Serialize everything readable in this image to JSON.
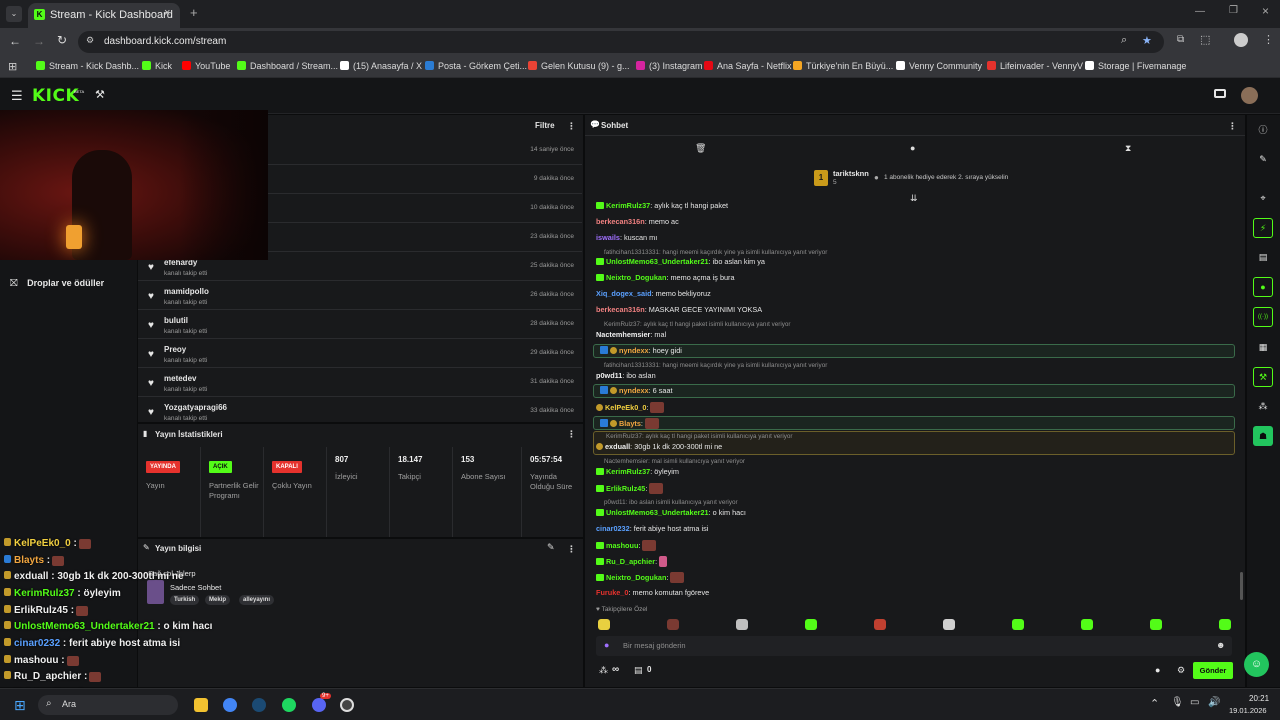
{
  "browser": {
    "tab_title": "Stream - Kick Dashboard",
    "url": "dashboard.kick.com/stream",
    "bookmarks": [
      {
        "label": "Stream - Kick Dashb...",
        "color": "#53fc18"
      },
      {
        "label": "Kick",
        "color": "#53fc18"
      },
      {
        "label": "YouTube",
        "color": "#ff0000"
      },
      {
        "label": "Dashboard / Stream...",
        "color": "#53fc18"
      },
      {
        "label": "(15) Anasayfa / X",
        "color": "#ffffff"
      },
      {
        "label": "Posta - Görkem Çeti...",
        "color": "#2b7cd3"
      },
      {
        "label": "Gelen Kutusu (9) - g...",
        "color": "#ea4335"
      },
      {
        "label": "(3) Instagram",
        "color": "#d6249f"
      },
      {
        "label": "Ana Sayfa - Netflix",
        "color": "#e50914"
      },
      {
        "label": "Türkiye'nin En Büyü...",
        "color": "#f5a623"
      },
      {
        "label": "Venny Community",
        "color": "#ffffff"
      },
      {
        "label": "Lifeinvader - VennyV",
        "color": "#e5322d"
      },
      {
        "label": "Storage | Fivemanage",
        "color": "#ffffff"
      }
    ]
  },
  "kick": {
    "logo": "KICK",
    "logo_beta": "BETA"
  },
  "sidebar": {
    "drops_label": "Droplar ve ödüller"
  },
  "activity": {
    "filter_label": "Filtre",
    "top_times": [
      "14 saniye önce",
      "9 dakika önce",
      "10 dakika önce",
      "23 dakika önce"
    ],
    "rows": [
      {
        "name": "efehardy",
        "sub": "kanalı takip etti",
        "time": "25 dakika önce"
      },
      {
        "name": "mamidpollo",
        "sub": "kanalı takip etti",
        "time": "26 dakika önce"
      },
      {
        "name": "bulutil",
        "sub": "kanalı takip etti",
        "time": "28 dakika önce"
      },
      {
        "name": "Preoy",
        "sub": "kanalı takip etti",
        "time": "29 dakika önce"
      },
      {
        "name": "metedev",
        "sub": "kanalı takip etti",
        "time": "31 dakika önce"
      },
      {
        "name": "Yozgatyapragi66",
        "sub": "kanalı takip etti",
        "time": "33 dakika önce"
      }
    ]
  },
  "stats": {
    "title": "Yayın İstatistikleri",
    "items": [
      {
        "badge": "YAYINDA",
        "badge_color": "#e5322d",
        "badge_text": "#ffffff",
        "label": "Yayın"
      },
      {
        "badge": "AÇIK",
        "badge_color": "#53fc18",
        "badge_text": "#0b0c0d",
        "label": "Partnerlik Gelir Programı"
      },
      {
        "badge": "KAPALI",
        "badge_color": "#e5322d",
        "badge_text": "#ffffff",
        "label": "Çoklu Yayın"
      },
      {
        "value": "807",
        "label": "İzleyici"
      },
      {
        "value": "18.147",
        "label": "Takipçi"
      },
      {
        "value": "153",
        "label": "Abone Sayısı"
      },
      {
        "value": "05:57:54",
        "label": "Yayında Olduğu Süre"
      }
    ]
  },
  "stream_info": {
    "title": "Yayın bilgisi",
    "stream_title": "Sağ sol Jblerp",
    "category": "Sadece Sohbet",
    "tags": [
      "Turkish",
      "Mekip",
      "alleyayını"
    ]
  },
  "chat": {
    "title": "Sohbet",
    "top_user": {
      "rank": "1",
      "name": "tariktsknn",
      "count": "5",
      "message": "1 abonelik hediye ederek 2. sıraya yükselin"
    },
    "lines": [
      {
        "type": "msg",
        "user": "KerimRulz37",
        "color": "#53fc18",
        "text": ": aylık kaç tl hangi paket"
      },
      {
        "type": "msg",
        "user": "berkecan316n",
        "color": "#f08080",
        "text": ": memo ac"
      },
      {
        "type": "msg",
        "user": "iswails",
        "color": "#a070ff",
        "text": ": kuscan mı"
      },
      {
        "type": "reply",
        "text": "fatihcihan13313331: hangi meemi kaçırdık yine ya isimli kullanıcıya yanıt veriyor"
      },
      {
        "type": "msg",
        "user": "UnlostMemo63_Undertaker21",
        "color": "#53fc18",
        "text": ": ibo aslan kim ya"
      },
      {
        "type": "msg",
        "user": "Neixtro_Dogukan",
        "color": "#53fc18",
        "text": ": memo açma iş bura"
      },
      {
        "type": "msg",
        "user": "Xiq_dogex_said",
        "color": "#5aa0ff",
        "text": ": memo bekliyoruz"
      },
      {
        "type": "msg",
        "user": "berkecan316n",
        "color": "#f08080",
        "text": ": MASKAR GECE YAYINIMI YOKSA"
      },
      {
        "type": "reply",
        "text": "KerimRulz37: aylık kaç tl hangi paket isimli kullanıcıya yanıt veriyor"
      },
      {
        "type": "msg",
        "user": "Nactemhemsier",
        "color": "#f0f0f0",
        "text": ": mal"
      },
      {
        "type": "msg",
        "user": "nyndexx",
        "color": "#f2a640",
        "text": ": hoey gidi"
      },
      {
        "type": "reply",
        "text": "fatihcihan13313331: hangi meemi kaçırdık yine ya isimli kullanıcıya yanıt veriyor"
      },
      {
        "type": "msg",
        "user": "p0wd11",
        "color": "#f0f0f0",
        "text": ": ibo aslan"
      },
      {
        "type": "msg",
        "user": "nyndexx",
        "color": "#f2a640",
        "text": ": 6 saat"
      },
      {
        "type": "msg",
        "user": "KelPeEk0_0",
        "color": "#f2d040",
        "text": ":"
      },
      {
        "type": "msg",
        "user": "Blayts",
        "color": "#f2a640",
        "text": ":"
      },
      {
        "type": "reply",
        "text": "KerimRulz37: aylık kaç tl hangi paket isimli kullanıcıya yanıt veriyor"
      },
      {
        "type": "msg",
        "user": "exduall",
        "color": "#f0f0f0",
        "text": ": 30gb 1k dk 200-300tl mi ne"
      },
      {
        "type": "reply",
        "text": "Nactemhemsier: mal isimli kullanıcıya yanıt veriyor"
      },
      {
        "type": "msg",
        "user": "KerimRulz37",
        "color": "#53fc18",
        "text": ": öyleyim"
      },
      {
        "type": "msg",
        "user": "ErlikRulz45",
        "color": "#53fc18",
        "text": ":"
      },
      {
        "type": "reply",
        "text": "p0wd11: ibo aslan isimli kullanıcıya yanıt veriyor"
      },
      {
        "type": "msg",
        "user": "UnlostMemo63_Undertaker21",
        "color": "#53fc18",
        "text": ": o kim hacı"
      },
      {
        "type": "msg",
        "user": "cinar0232",
        "color": "#5aa0ff",
        "text": ": ferit abiye host atma isi"
      },
      {
        "type": "msg",
        "user": "mashouu",
        "color": "#53fc18",
        "text": ":"
      },
      {
        "type": "msg",
        "user": "Ru_D_apchier",
        "color": "#53fc18",
        "text": ":"
      },
      {
        "type": "msg",
        "user": "Neixtro_Dogukan",
        "color": "#53fc18",
        "text": ":"
      },
      {
        "type": "msg",
        "user": "Furuke_0",
        "color": "#e5322d",
        "text": ": memo komutan fgöreve"
      }
    ],
    "followers_only_label": "Takipçilere Özel",
    "input_placeholder": "Bir mesaj gönderin",
    "points_label": "∞",
    "zero_label": "0",
    "send_label": "Gönder"
  },
  "overlay_chat": [
    {
      "user": "KelPeEk0_0",
      "color": "#f2d040",
      "text": " :"
    },
    {
      "user": "Blayts",
      "color": "#f2a640",
      "text": " :"
    },
    {
      "user": "exduall",
      "color": "#f0f0f0",
      "text": " : 30gb 1k dk 200-300tl mi ne"
    },
    {
      "user": "KerimRulz37",
      "color": "#53fc18",
      "text": " : öyleyim"
    },
    {
      "user": "ErlikRulz45",
      "color": "#f0f0f0",
      "text": " :"
    },
    {
      "user": "UnlostMemo63_Undertaker21",
      "color": "#53fc18",
      "text": " : o kim hacı"
    },
    {
      "user": "cinar0232",
      "color": "#5aa0ff",
      "text": " : ferit abiye host atma isi"
    },
    {
      "user": "mashouu",
      "color": "#f0f0f0",
      "text": " :"
    },
    {
      "user": "Ru_D_apchier",
      "color": "#f0f0f0",
      "text": " :"
    },
    {
      "user": "Neixtro_Dogukan",
      "color": "#53fc18",
      "text": " :"
    },
    {
      "user": "Furuke_0",
      "color": "#e5322d",
      "text": " : memo komutan fgöreve"
    }
  ],
  "taskbar": {
    "search_label": "Ara",
    "time": "20:21",
    "date": "19.01.2026",
    "badge_count": "9+"
  }
}
